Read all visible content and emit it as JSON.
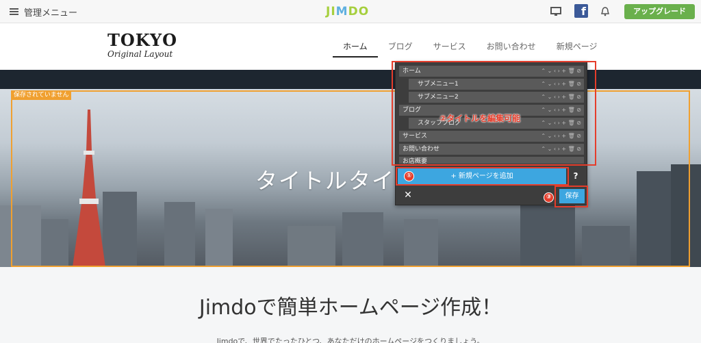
{
  "topbar": {
    "menu_label": "管理メニュー",
    "logo": "JIMDO",
    "upgrade_label": "アップグレード",
    "fb_glyph": "f"
  },
  "site": {
    "logo_main": "TOKYO",
    "logo_sub": "Original Layout",
    "nav": [
      "ホーム",
      "ブログ",
      "サービス",
      "お問い合わせ",
      "新規ページ"
    ],
    "active_nav": "ホーム"
  },
  "hero": {
    "badge": "保存されていません",
    "title": "タイトルタイ"
  },
  "nav_editor": {
    "rows": [
      {
        "label": "ホーム",
        "level": 0
      },
      {
        "label": "サブメニュー1",
        "level": 1
      },
      {
        "label": "サブメニュー2",
        "level": 1
      },
      {
        "label": "ブログ",
        "level": 0
      },
      {
        "label": "スタッフブログ",
        "level": 1
      },
      {
        "label": "サービス",
        "level": 0
      },
      {
        "label": "お問い合わせ",
        "level": 0
      },
      {
        "label": "お店概要",
        "level": 0
      }
    ],
    "add_page_label": "+ 新規ページを追加",
    "help_label": "?",
    "close_label": "✕",
    "save_label": "保存"
  },
  "annotations": {
    "marker1": "①",
    "marker2": "②",
    "marker3": "③",
    "text2": "②タイトルを編集可能",
    "color": "#e53d2b"
  },
  "content": {
    "heading": "Jimdoで簡単ホームページ作成！",
    "sub": "Jimdoで、世界でたったひとつ、あなただけのホームページをつくりましょう。"
  },
  "colors": {
    "accent_green": "#6ab04c",
    "button_blue": "#3da6e0",
    "frame_orange": "#f0a030"
  }
}
